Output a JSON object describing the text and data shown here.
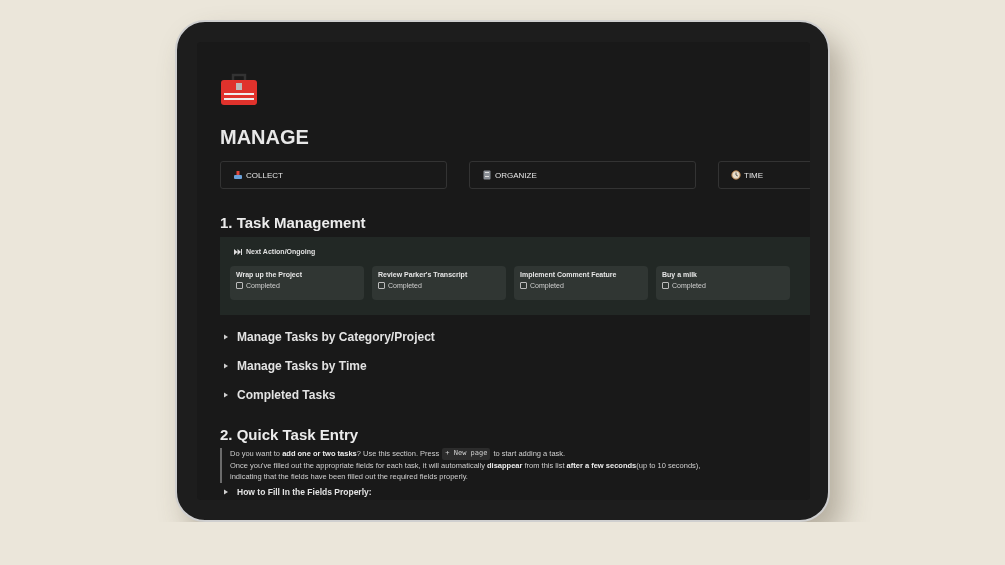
{
  "page": {
    "title": "MANAGE"
  },
  "links": [
    {
      "label": "COLLECT",
      "kind": "tray"
    },
    {
      "label": "ORGANIZE",
      "kind": "cabinet"
    },
    {
      "label": "TIME",
      "kind": "clock"
    }
  ],
  "sections": [
    {
      "heading": "1. Task Management"
    }
  ],
  "board": {
    "view": "Next Action/Ongoing",
    "cards": [
      {
        "title": "Wrap up the Project",
        "property": "Completed",
        "checked": false
      },
      {
        "title": "Review Parker's Transcript",
        "property": "Completed",
        "checked": false
      },
      {
        "title": "Implement Comment Feature",
        "property": "Completed",
        "checked": false
      },
      {
        "title": "Buy a milk",
        "property": "Completed",
        "checked": false
      }
    ]
  },
  "toggles": [
    {
      "label": "Manage Tasks by Category/Project",
      "expanded": false
    },
    {
      "label": "Manage Tasks by Time",
      "expanded": false
    },
    {
      "label": "Completed Tasks",
      "expanded": false
    }
  ],
  "quick_entry": {
    "heading": "2. Quick Task Entry",
    "line_1_start": "Do you want to **add one or two tasks**? Use this section. Press",
    "code": "+ New page",
    "line_1_end": "to start adding a task.",
    "line_2": "Once you've filled out the appropriate fields for each task, it will automatically **disappear** from this list **after a few seconds**(up to 10 seconds),",
    "line_3": "indicating that the fields have been filled out the required fields properly.",
    "toggle": {
      "label": "How to Fill In the Fields Properly:",
      "expanded": false
    }
  }
}
